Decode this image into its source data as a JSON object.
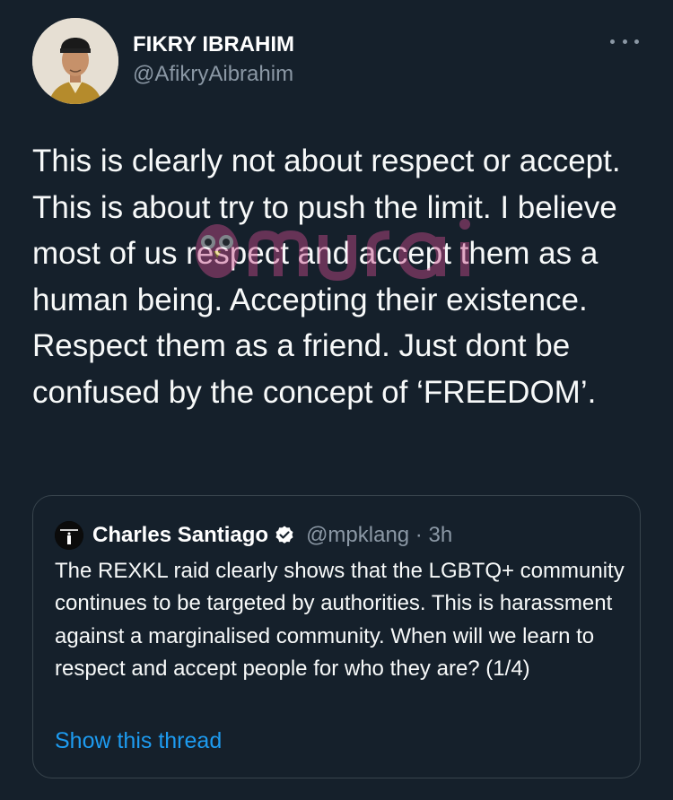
{
  "tweet": {
    "author": {
      "display_name": "FIKRY IBRAHIM",
      "handle": "@AfikryAibrahim",
      "avatar_icon": "profile-photo"
    },
    "more_icon": "ellipsis-icon",
    "text": "This is clearly not about respect or accept. This is about try to push the limit. I believe most of us respect and accept them as a human being. Accepting their existence. Respect them as a friend. Just dont be confused by the concept of ‘FREEDOM’."
  },
  "watermark": {
    "text": "murai",
    "icon": "owl-logo",
    "color": "#c94b8a"
  },
  "quoted_tweet": {
    "author": {
      "display_name": "Charles Santiago",
      "verified_icon": "verified-badge-icon",
      "handle_time": "@mpklang · 3h"
    },
    "text": "The REXKL raid clearly shows that the LGBTQ+ community continues to be targeted by authorities. This is harassment against a marginalised community. When will we learn to respect and accept people for who they are? (1/4)",
    "show_thread_label": "Show this thread"
  },
  "colors": {
    "background": "#15202b",
    "text": "#f7f9f9",
    "secondary": "#8b98a5",
    "border": "#38444d",
    "link": "#1d9bf0"
  }
}
